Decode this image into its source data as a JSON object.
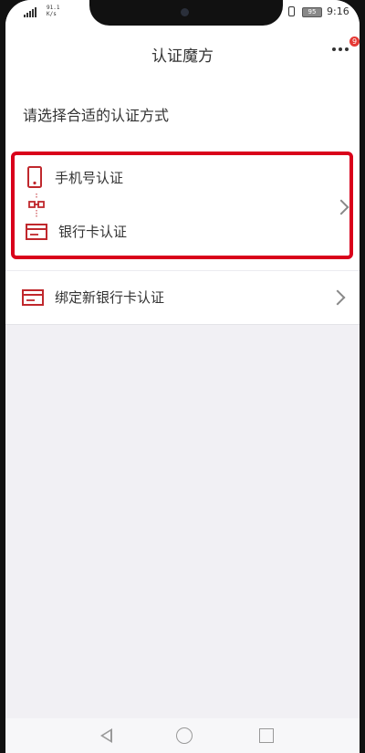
{
  "status_bar": {
    "network_speed_top": "91.1",
    "network_speed_bottom": "K/s",
    "battery_level": "95",
    "time": "9:16"
  },
  "header": {
    "title": "认证魔方",
    "more_icon": "more-dots-icon",
    "badge_count": "9"
  },
  "content": {
    "prompt": "请选择合适的认证方式",
    "option_group": {
      "phone_label": "手机号认证",
      "phone_icon": "phone-icon",
      "link_icon": "link-icon",
      "bank_label": "银行卡认证",
      "bank_icon": "bank-card-icon",
      "highlight_color": "#d9001b"
    },
    "bind_option": {
      "label": "绑定新银行卡认证",
      "icon": "bank-card-icon"
    }
  },
  "colors": {
    "accent": "#c0282d",
    "background": "#f1f0f4"
  }
}
